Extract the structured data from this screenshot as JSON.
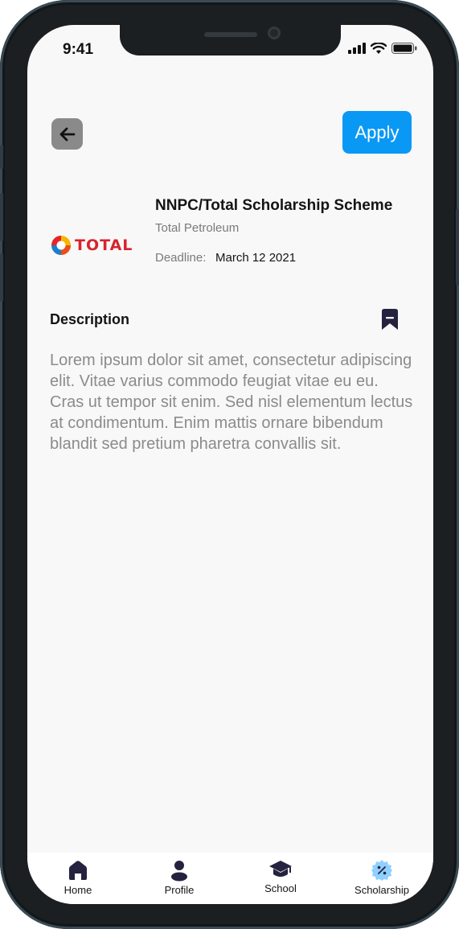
{
  "status_bar": {
    "time": "9:41"
  },
  "header": {
    "apply_label": "Apply"
  },
  "scholarship": {
    "logo_text": "TOTAL",
    "title": "NNPC/Total Scholarship Scheme",
    "company": "Total Petroleum",
    "deadline_label": "Deadline:",
    "deadline_value": "March 12 2021"
  },
  "description": {
    "heading": "Description",
    "body": "Lorem ipsum dolor sit amet, consectetur adipiscing elit. Vitae varius commodo feugiat vitae eu eu. Cras ut tempor sit enim. Sed nisl elementum lectus at condimentum. Enim mattis ornare bibendum blandit sed pretium pharetra convallis sit."
  },
  "bottom_nav": {
    "items": [
      {
        "label": "Home",
        "icon": "home-icon"
      },
      {
        "label": "Profile",
        "icon": "user-icon"
      },
      {
        "label": "School",
        "icon": "graduation-cap-icon"
      },
      {
        "label": "Scholarship",
        "icon": "discount-badge-icon",
        "active": true
      }
    ]
  },
  "colors": {
    "accent": "#0a98f5",
    "brand_red": "#d6242e",
    "active_icon": "#8fd0ff"
  }
}
